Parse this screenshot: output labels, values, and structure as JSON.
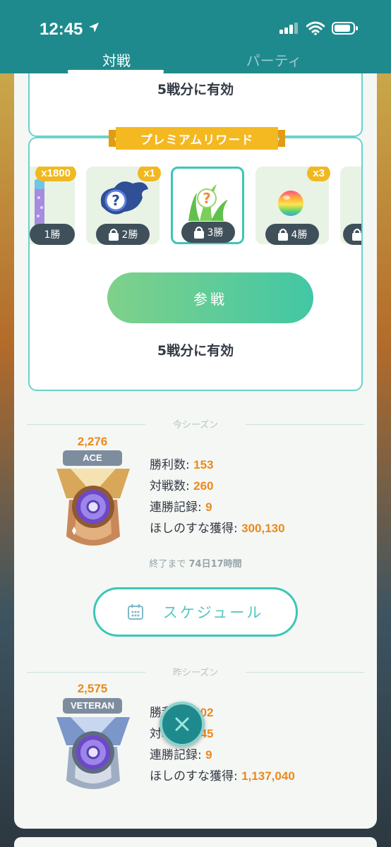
{
  "status_bar": {
    "time": "12:45",
    "icons": [
      "location-arrow-icon",
      "signal-icon",
      "wifi-icon",
      "battery-icon"
    ]
  },
  "tabs": [
    {
      "label": "対戦",
      "active": true
    },
    {
      "label": "パーティ",
      "active": false
    }
  ],
  "free_track": {
    "valid_text": "5戦分に有効"
  },
  "premium": {
    "banner": "プレミアムリワード",
    "rewards": [
      {
        "count": "x1800",
        "wins": "1勝",
        "locked": false,
        "item": "stardust-icon"
      },
      {
        "count": "x1",
        "wins": "2勝",
        "locked": true,
        "item": "mystery-encounter-icon"
      },
      {
        "count": "",
        "wins": "3勝",
        "locked": true,
        "item": "mystery-grass-encounter-icon",
        "selected": true
      },
      {
        "count": "x3",
        "wins": "4勝",
        "locked": true,
        "item": "rainbow-candy-icon"
      },
      {
        "count": "",
        "wins": "",
        "locked": true,
        "item": "reward-icon"
      }
    ],
    "join_label": "参戦",
    "valid_text": "5戦分に有効"
  },
  "current_season": {
    "title": "今シーズン",
    "rating": "2,276",
    "rank": "ACE",
    "stats": [
      {
        "label": "勝利数: ",
        "value": "153"
      },
      {
        "label": "対戦数: ",
        "value": "260"
      },
      {
        "label": "連勝記録: ",
        "value": "9"
      },
      {
        "label": "ほしのすな獲得: ",
        "value": "300,130"
      }
    ],
    "remaining_prefix": "終了まで",
    "remaining_value": "74日17時間",
    "schedule_label": "スケジュール"
  },
  "previous_season": {
    "title": "昨シーズン",
    "rating": "2,575",
    "rank": "VETERAN",
    "stats": [
      {
        "label": "勝利数: ",
        "value": "402"
      },
      {
        "label": "対戦数: ",
        "value": "745"
      },
      {
        "label": "連勝記録: ",
        "value": "9"
      },
      {
        "label": "ほしのすな獲得: ",
        "value": "1,137,040"
      }
    ]
  },
  "colors": {
    "header": "#1f8a8d",
    "accent": "#3cc6b7",
    "value": "#ea8a1d",
    "badge": "#f1b81f",
    "pill": "#3f505a"
  }
}
